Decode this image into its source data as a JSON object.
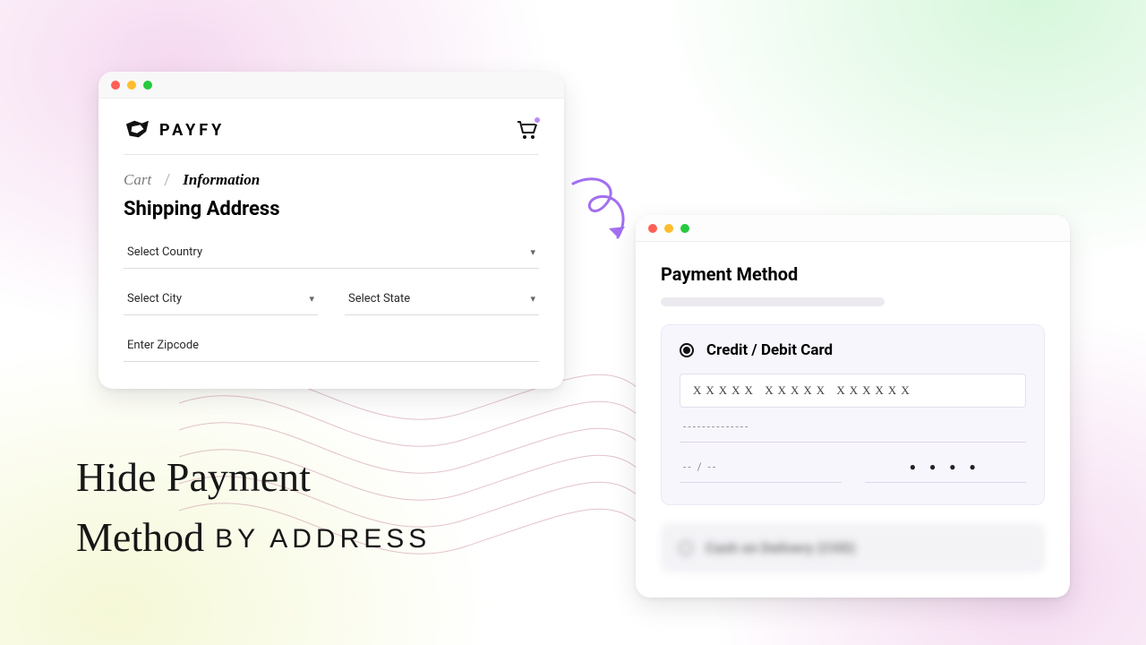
{
  "shipping": {
    "brand": "PAYFY",
    "breadcrumb": {
      "cart": "Cart",
      "sep": "/",
      "info": "Information"
    },
    "title": "Shipping Address",
    "fields": {
      "country": "Select Country",
      "city": "Select City",
      "state": "Select State",
      "zipcode": "Enter Zipcode"
    }
  },
  "payment": {
    "title": "Payment Method",
    "card_option": "Credit / Debit Card",
    "card_number": "XXXXX XXXXX XXXXXX",
    "name_placeholder": "--------------",
    "exp_placeholder": "-- / --",
    "cvv_placeholder": "● ● ● ●",
    "hidden_option": "Cash on Delivery (COD)"
  },
  "headline": {
    "line1": "Hide Payment",
    "line2a": "Method",
    "line2b": "BY ADDRESS"
  },
  "icons": {
    "chevron": "▾"
  }
}
